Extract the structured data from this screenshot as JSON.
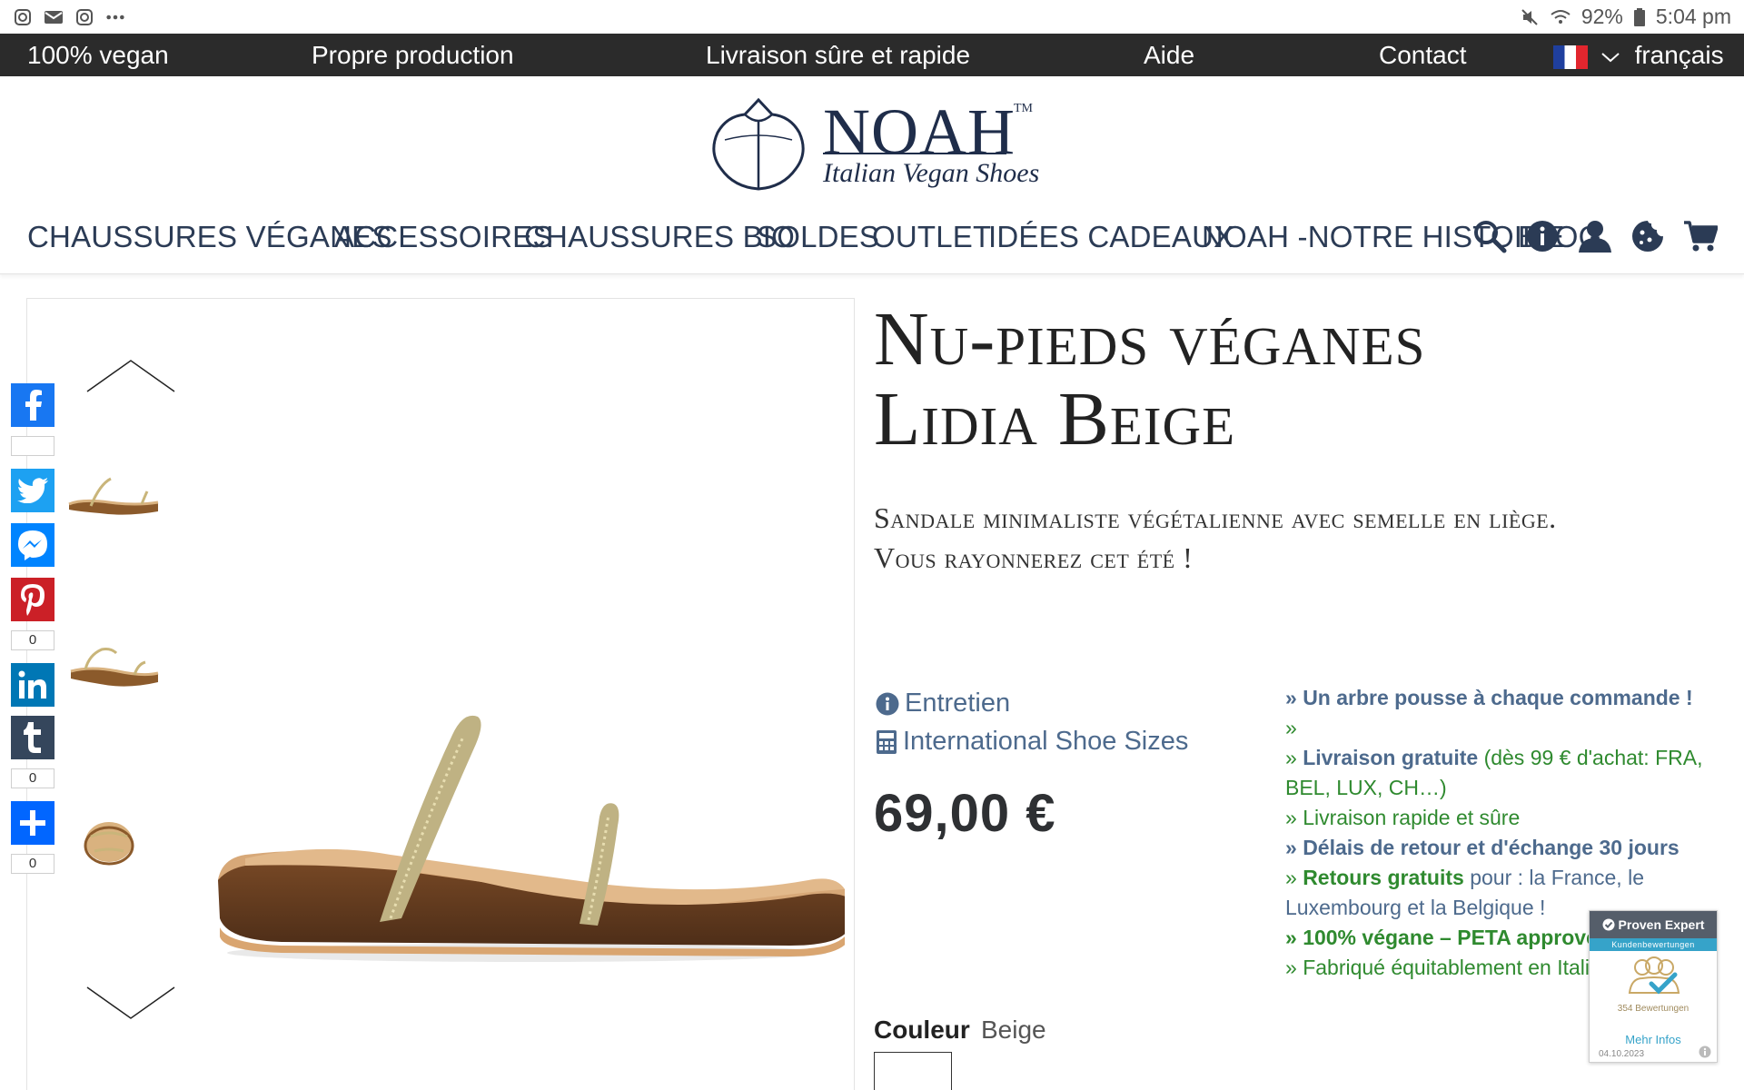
{
  "status_bar": {
    "battery": "92%",
    "time": "5:04 pm"
  },
  "info_bar": {
    "items": [
      "100% vegan",
      "Propre production",
      "Livraison sûre et rapide",
      "Aide",
      "Contact"
    ],
    "language": "français"
  },
  "logo": {
    "name": "NOAH",
    "tm": "TM",
    "tagline": "Italian Vegan Shoes"
  },
  "nav": {
    "items": [
      "CHAUSSURES VÉGANES",
      "ACCESSOIRES",
      "CHAUSSURES BIO",
      "SOLDES",
      "OUTLET",
      "IDÉES CADEAUX",
      "NOAH -NOTRE HISTOIRE",
      "BLOG"
    ]
  },
  "share": {
    "counts": [
      "0",
      "0",
      "0"
    ]
  },
  "product": {
    "title_line1": "Nu-pieds véganes",
    "title_line2": "Lidia Beige",
    "subtitle_line1": "Sandale minimaliste végétalienne avec semelle en liège.",
    "subtitle_line2": "Vous rayonnerez cet été !",
    "care_link": "Entretien",
    "sizes_link": "International Shoe Sizes",
    "price": "69,00 €",
    "color_label": "Couleur",
    "color_value": "Beige"
  },
  "benefits": {
    "b1": "Un arbre pousse à chaque commande !",
    "b2": "",
    "b3_bold": "Livraison gratuite",
    "b3_rest": "(dès 99 € d'achat: FRA, BEL, LUX, CH…)",
    "b4": "Livraison rapide et sûre",
    "b5": "Délais de retour et d'échange 30 jours",
    "b6_bold": "Retours gratuits",
    "b6_rest": "pour : la France, le Luxembourg et la Belgique !",
    "b7": "100% végane – PETA approved",
    "b8": "Fabriqué équitablement en Italie"
  },
  "proven_expert": {
    "brand": "Proven Expert",
    "band": "Kundenbewertungen",
    "reviews": "354 Bewertungen",
    "more": "Mehr Infos",
    "date": "04.10.2023"
  },
  "colors": {
    "infobar_bg": "#2b2b2b",
    "nav_text": "#2b3b55",
    "link_blue": "#4d6a8d",
    "benefit_green": "#2f8a2f",
    "facebook": "#1877f2",
    "twitter": "#1da1f2",
    "messenger": "#0084ff",
    "pinterest": "#cb2027",
    "linkedin": "#0077b5",
    "tumblr": "#35465c",
    "share_plus": "#0166ff"
  }
}
